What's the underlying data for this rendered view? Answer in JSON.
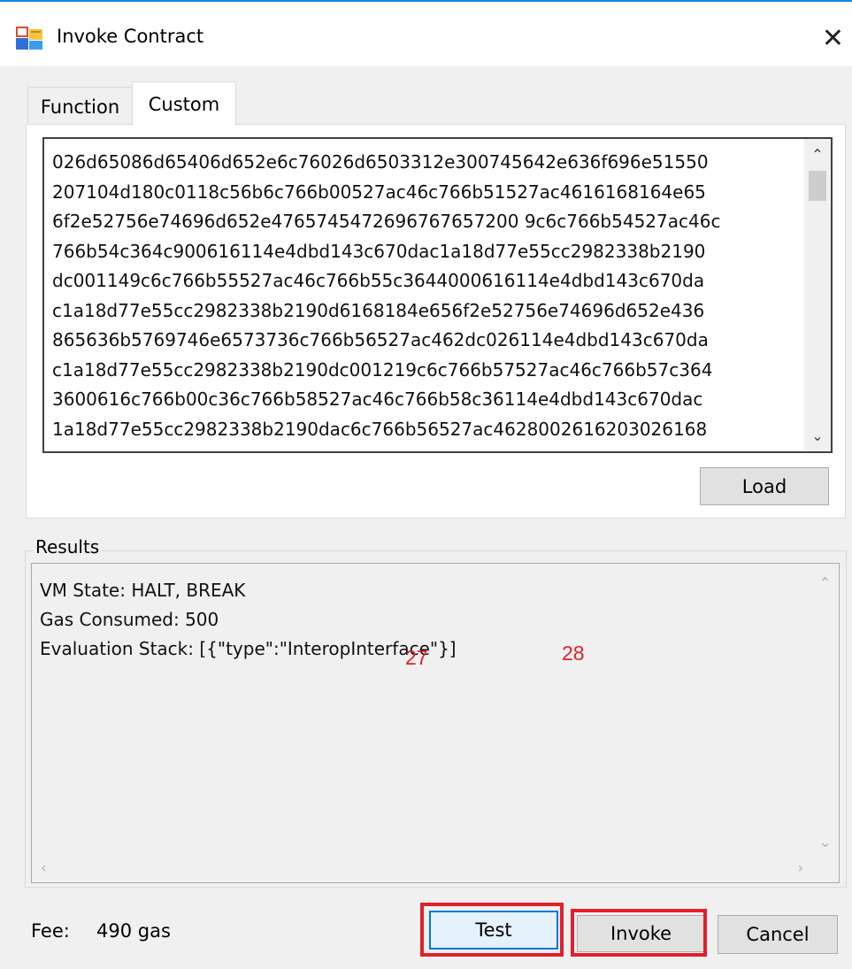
{
  "window": {
    "title": "Invoke Contract",
    "close_glyph": "✕",
    "app_icon": "window-app-icon"
  },
  "tabs": [
    {
      "label": "Function",
      "selected": false
    },
    {
      "label": "Custom",
      "selected": true
    }
  ],
  "script": {
    "lines": [
      "026d65086d65406d652e6c76026d6503312e300745642e636f696e51550",
      "207104d180c0118c56b6c766b00527ac46c766b51527ac4616168164e65",
      "6f2e52756e74696d652e4765745472696767657200 9c6c766b54527ac46c",
      "766b54c364c900616114e4dbd143c670dac1a18d77e55cc2982338b2190",
      "dc001149c6c766b55527ac46c766b55c3644000616114e4dbd143c670da",
      "c1a18d77e55cc2982338b2190d6168184e656f2e52756e74696d652e436",
      "865636b5769746e6573736c766b56527ac462dc026114e4dbd143c670da",
      "c1a18d77e55cc2982338b2190dc001219c6c766b57527ac46c766b57c364",
      "3600616c766b00c36c766b58527ac46c766b58c36114e4dbd143c670dac",
      "1a18d77e55cc2982338b2190dac6c766b56527ac4628002616203026168"
    ],
    "load_label": "Load"
  },
  "results": {
    "group_label": "Results",
    "lines": [
      "VM State: HALT, BREAK",
      "Gas Consumed: 500",
      "Evaluation Stack: [{\"type\":\"InteropInterface\"}]"
    ]
  },
  "footer": {
    "fee_label": "Fee:",
    "fee_value": "490 gas",
    "test_label": "Test",
    "invoke_label": "Invoke",
    "cancel_label": "Cancel"
  },
  "annotations": {
    "step_test": "27",
    "step_invoke": "28",
    "highlight_color": "#e0202a"
  },
  "colors": {
    "accent": "#0078d7",
    "title_border": "#1883d7"
  }
}
